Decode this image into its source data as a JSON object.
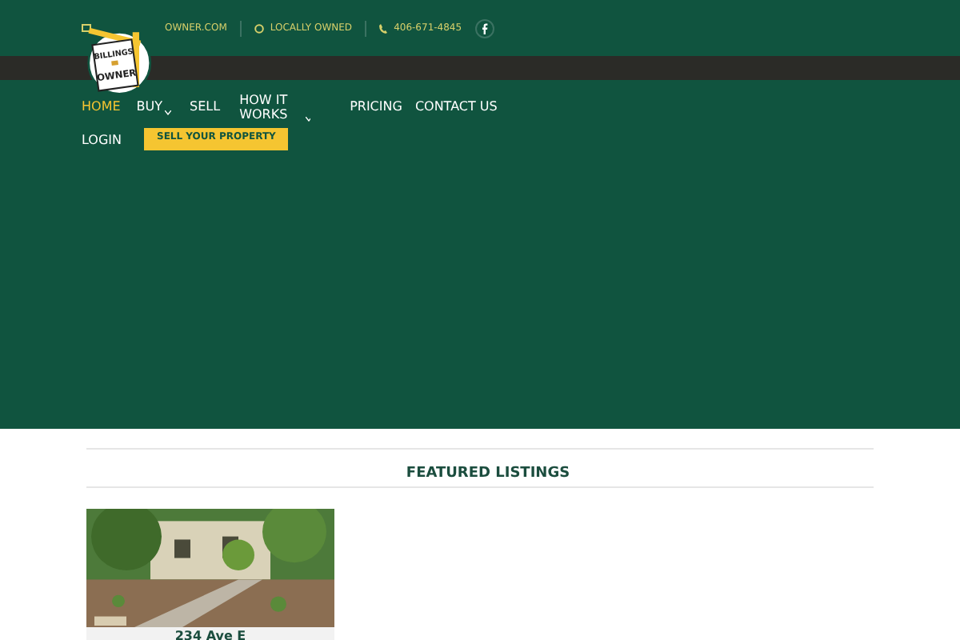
{
  "topbar": {
    "email": "OWNER.COM",
    "tagline": "LOCALLY OWNED",
    "phone": "406-671-4845"
  },
  "logo": {
    "line1": "BILLINGS",
    "line2": "OWNER"
  },
  "nav": [
    {
      "label": "HOME",
      "selected": true,
      "dropdown": false
    },
    {
      "label": "BUY",
      "selected": false,
      "dropdown": true
    },
    {
      "label": "SELL",
      "selected": false,
      "dropdown": false
    },
    {
      "label": "HOW IT WORKS",
      "selected": false,
      "dropdown": true
    },
    {
      "label": "PRICING",
      "selected": false,
      "dropdown": false
    },
    {
      "label": "CONTACT US",
      "selected": false,
      "dropdown": false
    }
  ],
  "login": "LOGIN",
  "cta": "SELL YOUR PROPERTY",
  "section_title": "FEATURED LISTINGS",
  "listings": [
    {
      "kind": "picture",
      "title": "234 Ave E"
    }
  ]
}
